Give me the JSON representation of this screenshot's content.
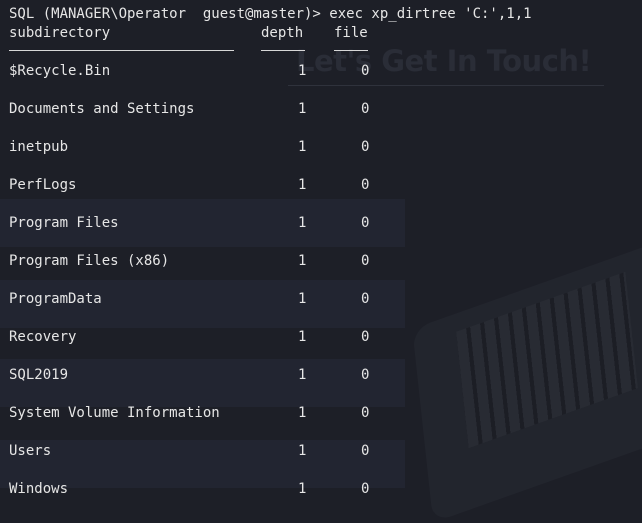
{
  "terminal": {
    "prompt": "SQL (MANAGER\\Operator  guest@master)> exec xp_dirtree 'C:',1,1",
    "columns": {
      "subdirectory": "subdirectory",
      "depth": "depth",
      "file": "file"
    },
    "rows": [
      {
        "subdirectory": "$Recycle.Bin",
        "depth": "1",
        "file": "0"
      },
      {
        "subdirectory": "Documents and Settings",
        "depth": "1",
        "file": "0"
      },
      {
        "subdirectory": "inetpub",
        "depth": "1",
        "file": "0"
      },
      {
        "subdirectory": "PerfLogs",
        "depth": "1",
        "file": "0"
      },
      {
        "subdirectory": "Program Files",
        "depth": "1",
        "file": "0"
      },
      {
        "subdirectory": "Program Files (x86)",
        "depth": "1",
        "file": "0"
      },
      {
        "subdirectory": "ProgramData",
        "depth": "1",
        "file": "0"
      },
      {
        "subdirectory": "Recovery",
        "depth": "1",
        "file": "0"
      },
      {
        "subdirectory": "SQL2019",
        "depth": "1",
        "file": "0"
      },
      {
        "subdirectory": "System Volume Information",
        "depth": "1",
        "file": "0"
      },
      {
        "subdirectory": "Users",
        "depth": "1",
        "file": "0"
      },
      {
        "subdirectory": "Windows",
        "depth": "1",
        "file": "0"
      }
    ]
  },
  "wallpaper": {
    "watermark_text": "Let's Get In Touch!"
  },
  "colors": {
    "background": "#1d1f27",
    "text": "#e6e6e6",
    "band": "#222531"
  }
}
